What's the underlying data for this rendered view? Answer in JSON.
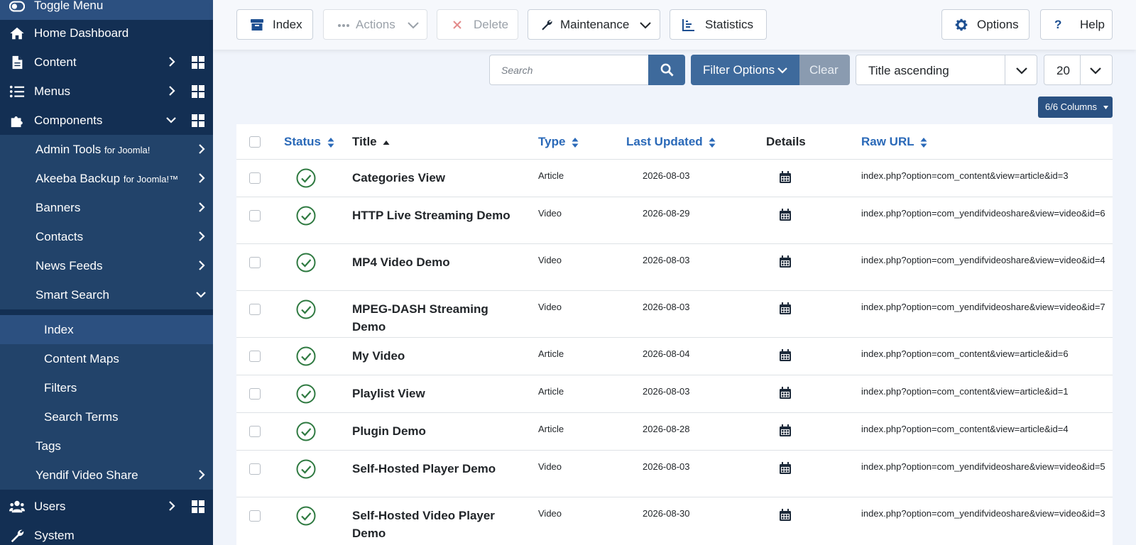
{
  "sidebar": {
    "toggle_menu": "Toggle Menu",
    "items": [
      {
        "label": "Home Dashboard"
      },
      {
        "label": "Content"
      },
      {
        "label": "Menus"
      },
      {
        "label": "Components"
      },
      {
        "label": "Admin Tools",
        "suffix": "for Joomla!"
      },
      {
        "label": "Akeeba Backup",
        "suffix": "for Joomla!™"
      },
      {
        "label": "Banners"
      },
      {
        "label": "Contacts"
      },
      {
        "label": "News Feeds"
      },
      {
        "label": "Smart Search"
      },
      {
        "label": "Index"
      },
      {
        "label": "Content Maps"
      },
      {
        "label": "Filters"
      },
      {
        "label": "Search Terms"
      },
      {
        "label": "Tags"
      },
      {
        "label": "Yendif Video Share"
      },
      {
        "label": "Users"
      },
      {
        "label": "System"
      }
    ]
  },
  "toolbar": {
    "index": "Index",
    "actions": "Actions",
    "delete": "Delete",
    "maintenance": "Maintenance",
    "statistics": "Statistics",
    "options": "Options",
    "help": "Help"
  },
  "filters": {
    "search_placeholder": "Search",
    "filter_options": "Filter Options",
    "clear": "Clear",
    "sort_value": "Title ascending",
    "limit_value": "20",
    "columns": "6/6 Columns"
  },
  "colors": {
    "sidebar_bg": "#132f53",
    "accent": "#3e6a9c",
    "published": "#2f7a41",
    "link": "#2a69b8"
  },
  "table": {
    "headers": {
      "status": "Status",
      "title": "Title",
      "type": "Type",
      "last_updated": "Last Updated",
      "details": "Details",
      "raw_url": "Raw URL"
    },
    "rows": [
      {
        "title": "Categories View",
        "type": "Article",
        "date": "2026-08-03",
        "url": "index.php?option=com_content&view=article&id=3"
      },
      {
        "title": "HTTP Live Streaming Demo",
        "type": "Video",
        "date": "2026-08-29",
        "url": "index.php?option=com_yendifvideoshare&view=video&id=6"
      },
      {
        "title": "MP4 Video Demo",
        "type": "Video",
        "date": "2026-08-03",
        "url": "index.php?option=com_yendifvideoshare&view=video&id=4"
      },
      {
        "title": "MPEG-DASH Streaming Demo",
        "type": "Video",
        "date": "2026-08-03",
        "url": "index.php?option=com_yendifvideoshare&view=video&id=7"
      },
      {
        "title": "My Video",
        "type": "Article",
        "date": "2026-08-04",
        "url": "index.php?option=com_content&view=article&id=6"
      },
      {
        "title": "Playlist View",
        "type": "Article",
        "date": "2026-08-03",
        "url": "index.php?option=com_content&view=article&id=1"
      },
      {
        "title": "Plugin Demo",
        "type": "Article",
        "date": "2026-08-28",
        "url": "index.php?option=com_content&view=article&id=4"
      },
      {
        "title": "Self-Hosted Player Demo",
        "type": "Video",
        "date": "2026-08-03",
        "url": "index.php?option=com_yendifvideoshare&view=video&id=5"
      },
      {
        "title": "Self-Hosted Video Player Demo",
        "type": "Video",
        "date": "2026-08-30",
        "url": "index.php?option=com_yendifvideoshare&view=video&id=3"
      }
    ]
  }
}
